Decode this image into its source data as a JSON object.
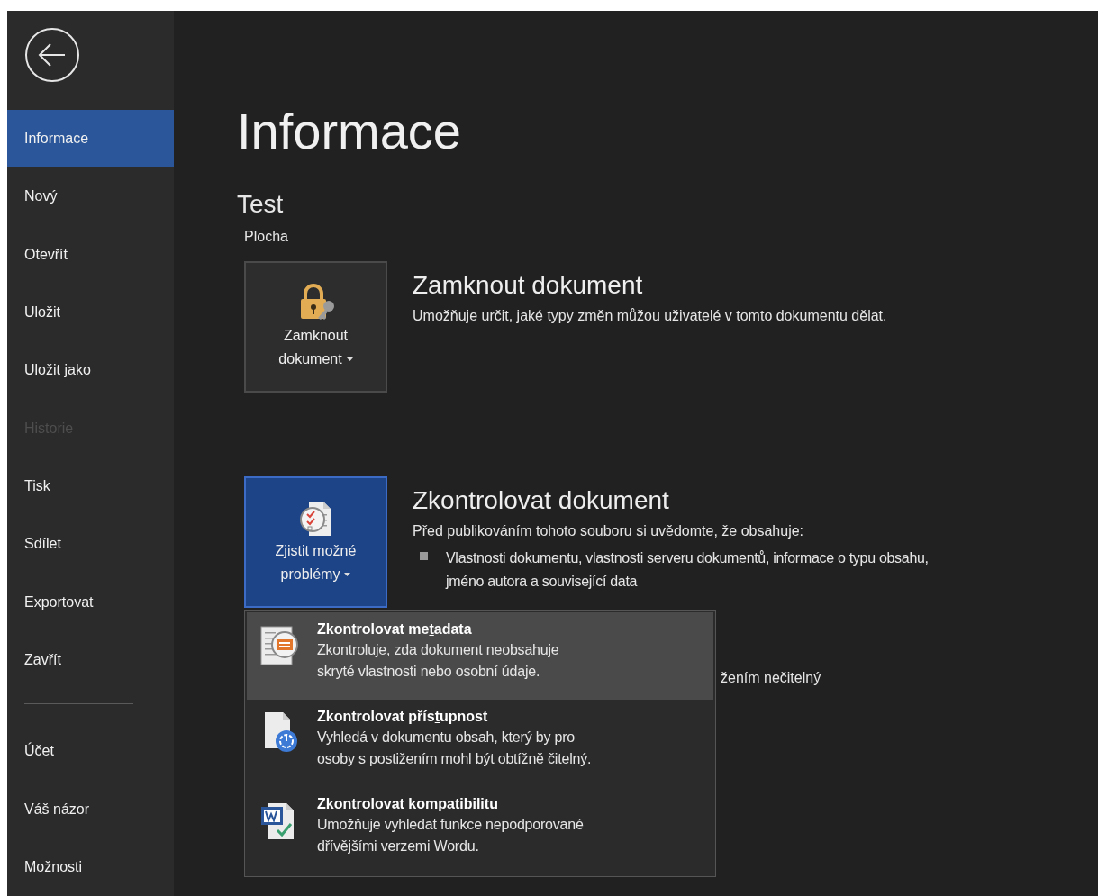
{
  "sidebar": {
    "items": [
      {
        "label": "Informace",
        "selected": true,
        "disabled": false
      },
      {
        "label": "Nový",
        "selected": false,
        "disabled": false
      },
      {
        "label": "Otevřít",
        "selected": false,
        "disabled": false
      },
      {
        "label": "Uložit",
        "selected": false,
        "disabled": false
      },
      {
        "label": "Uložit jako",
        "selected": false,
        "disabled": false
      },
      {
        "label": "Historie",
        "selected": false,
        "disabled": true
      },
      {
        "label": "Tisk",
        "selected": false,
        "disabled": false
      },
      {
        "label": "Sdílet",
        "selected": false,
        "disabled": false
      },
      {
        "label": "Exportovat",
        "selected": false,
        "disabled": false
      },
      {
        "label": "Zavřít",
        "selected": false,
        "disabled": false
      }
    ],
    "footer_items": [
      {
        "label": "Účet",
        "selected": false,
        "disabled": false
      },
      {
        "label": "Váš názor",
        "selected": false,
        "disabled": false
      },
      {
        "label": "Možnosti",
        "selected": false,
        "disabled": false
      }
    ]
  },
  "page_title": "Informace",
  "document": {
    "name": "Test",
    "location": "Plocha"
  },
  "sections": [
    {
      "button": {
        "lines": [
          "Zamknout",
          "dokument"
        ],
        "selected": false
      },
      "title": "Zamknout dokument",
      "description": "Umožňuje určit, jaké typy změn můžou uživatelé v tomto dokumentu dělat."
    },
    {
      "button": {
        "lines": [
          "Zjistit možné",
          "problémy"
        ],
        "selected": true
      },
      "title": "Zkontrolovat dokument",
      "description": "Před publikováním tohoto souboru si uvědomte, že obsahuje:",
      "bullets": [
        {
          "lines": [
            "Vlastnosti dokumentu, vlastnosti serveru dokumentů, informace o typu obsahu,",
            "jméno autora a související data"
          ]
        }
      ],
      "hidden_fragment": "žením nečitelný",
      "menu": {
        "items": [
          {
            "title": {
              "before": "Zkontrolovat me",
              "key": "t",
              "after": "adata"
            },
            "lines": [
              "Zkontroluje, zda dokument neobsahuje",
              "skryté vlastnosti nebo osobní údaje."
            ],
            "selected": true
          },
          {
            "title": {
              "before": "Zkontrolovat přís",
              "key": "t",
              "after": "upnost"
            },
            "lines": [
              "Vyhledá v dokumentu obsah, který by pro",
              "osoby s postižením mohl být obtížně čitelný."
            ],
            "selected": false
          },
          {
            "title": {
              "before": "Zkontrolovat ko",
              "key": "m",
              "after": "patibilitu"
            },
            "lines": [
              "Umožňuje vyhledat funkce nepodporované",
              "dřívějšími verzemi Wordu."
            ],
            "selected": false
          }
        ]
      }
    }
  ]
}
